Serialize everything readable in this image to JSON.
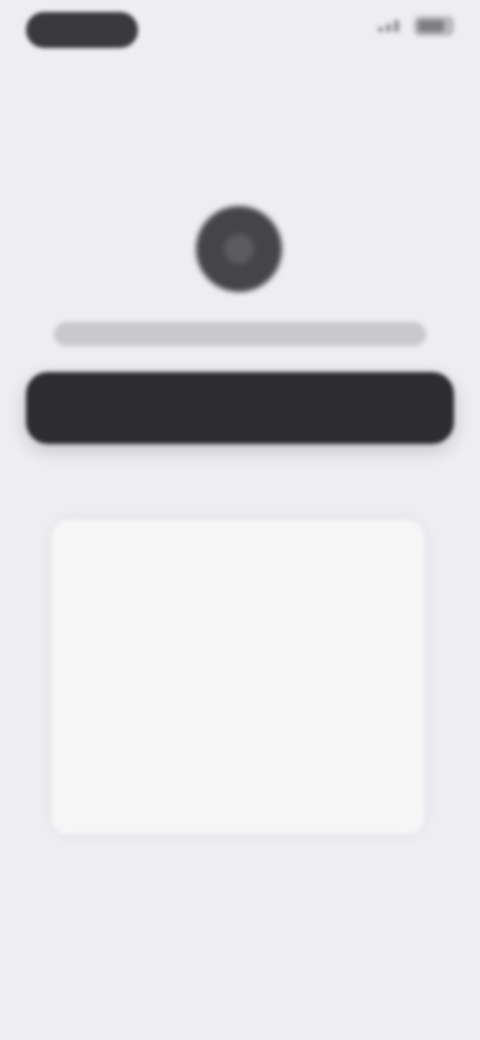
{
  "status_bar": {
    "time": "",
    "signal_icon": "signal-icon",
    "battery_icon": "battery-icon"
  },
  "profile": {
    "avatar_icon": "avatar-icon",
    "title": ""
  },
  "primary_button": {
    "label": ""
  },
  "card": {
    "content": ""
  },
  "colors": {
    "background": "#eeedf2",
    "pill": "#3a3a3c",
    "button": "#2d2d2f",
    "card": "#f6f6f7"
  }
}
